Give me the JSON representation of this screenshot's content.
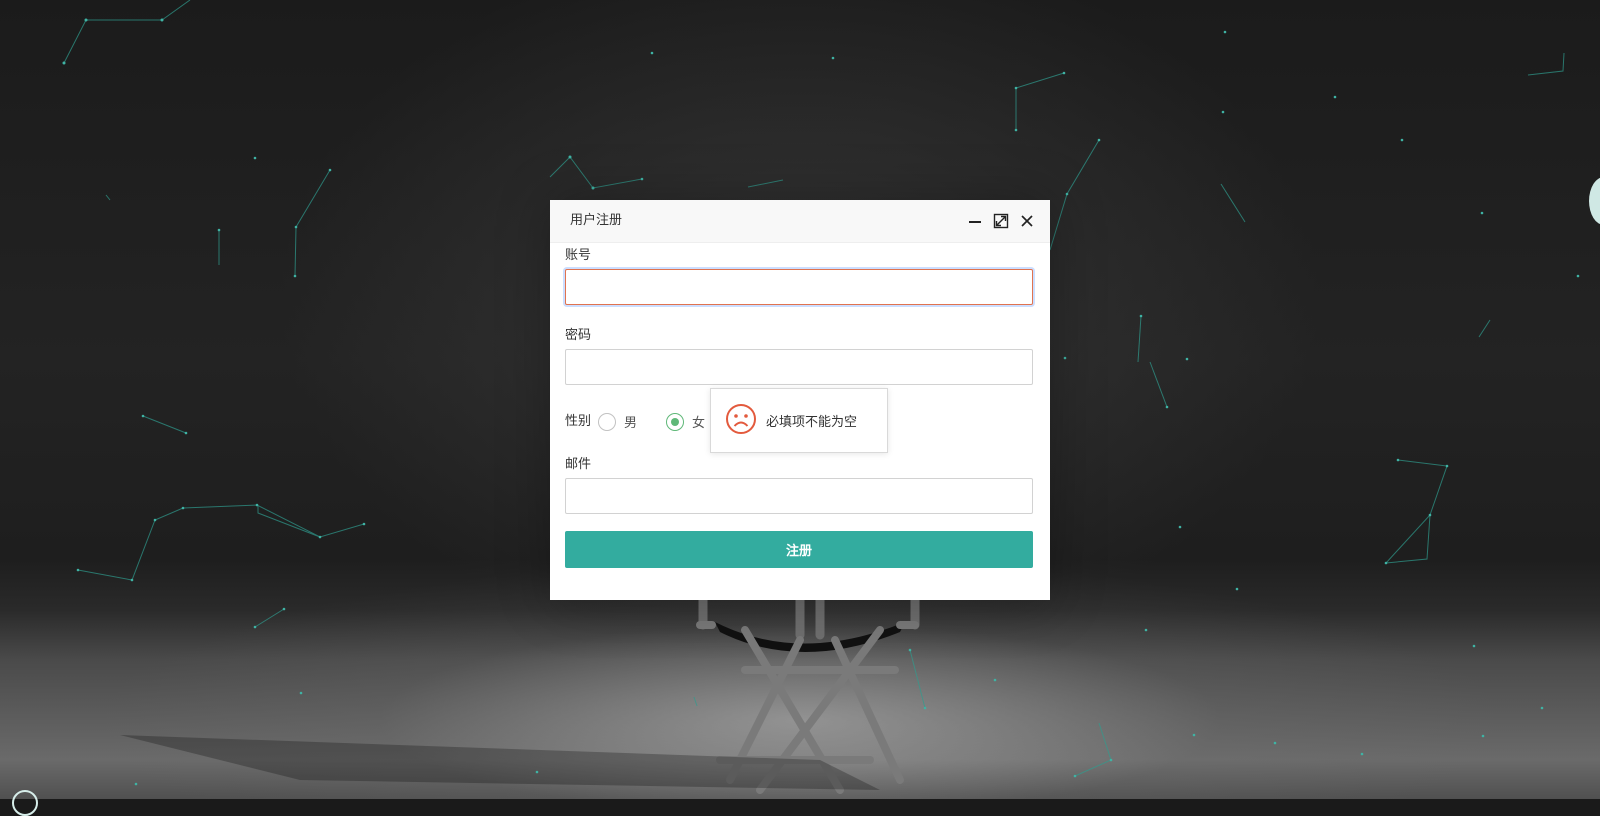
{
  "dialog": {
    "title": "用户注册",
    "controls": [
      "minimize-icon",
      "maximize-icon",
      "close-icon"
    ]
  },
  "form": {
    "account_label": "账号",
    "account_value": "",
    "password_label": "密码",
    "password_value": "",
    "gender_label": "性别",
    "gender_options": [
      {
        "label": "男",
        "selected": false
      },
      {
        "label": "女",
        "selected": true
      }
    ],
    "email_label": "邮件",
    "email_value": "",
    "submit_label": "注册"
  },
  "toast": {
    "icon": "sad-face-icon",
    "message": "必填项不能为空"
  },
  "colors": {
    "accent": "#33ac9f",
    "radio_checked": "#5fb878",
    "error_icon": "#e35a3d",
    "particle_line": "#37a89a"
  }
}
